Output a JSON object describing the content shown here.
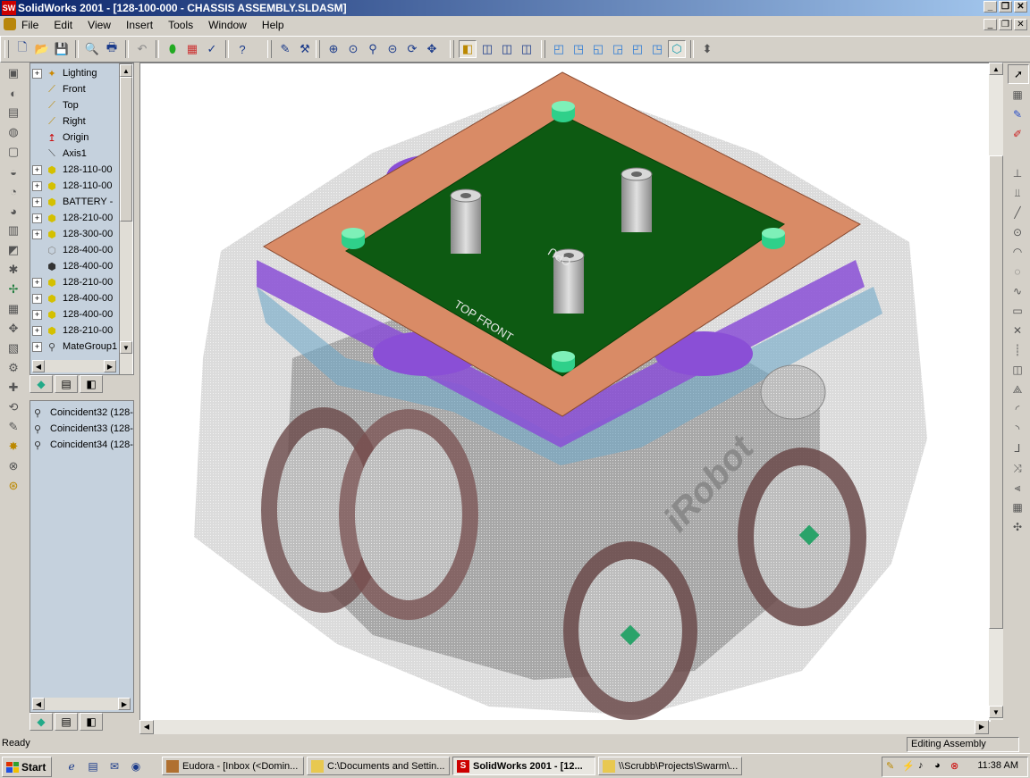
{
  "window": {
    "title": "SolidWorks 2001 - [128-100-000 - CHASSIS ASSEMBLY.SLDASM]",
    "app_icon_text": "SW",
    "controls": {
      "minimize": "_",
      "restore": "❐",
      "close": "✕"
    }
  },
  "menubar": {
    "items": [
      "File",
      "Edit",
      "View",
      "Insert",
      "Tools",
      "Window",
      "Help"
    ]
  },
  "toolbar": {
    "buttons": [
      "new-icon",
      "open-icon",
      "save-icon",
      "print-preview-icon",
      "print-icon",
      "undo-icon",
      "traffic-light-icon",
      "color-palette-icon",
      "options-icon",
      "whats-this-icon",
      "sketch-icon",
      "smart-mate-icon",
      "zoom-fit-icon",
      "zoom-area-icon",
      "zoom-in-out-icon",
      "zoom-selection-icon",
      "rotate-icon",
      "pan-icon",
      "wireframe-icon",
      "hidden-lines-visible-icon",
      "hidden-lines-removed-icon",
      "shaded-edges-icon",
      "front-view-icon",
      "back-view-icon",
      "left-view-icon",
      "right-view-icon",
      "top-view-icon",
      "isometric-view-icon",
      "normal-to-icon"
    ]
  },
  "feature_tree": {
    "items": [
      {
        "label": "Lighting",
        "expandable": true,
        "icon": "lighting-folder-icon"
      },
      {
        "label": "Front",
        "expandable": false,
        "icon": "plane-icon"
      },
      {
        "label": "Top",
        "expandable": false,
        "icon": "plane-icon"
      },
      {
        "label": "Right",
        "expandable": false,
        "icon": "plane-icon"
      },
      {
        "label": "Origin",
        "expandable": false,
        "icon": "origin-icon"
      },
      {
        "label": "Axis1",
        "expandable": false,
        "icon": "axis-icon"
      },
      {
        "label": "128-110-00",
        "expandable": true,
        "icon": "part-icon"
      },
      {
        "label": "128-110-00",
        "expandable": true,
        "icon": "part-icon"
      },
      {
        "label": "BATTERY -",
        "expandable": true,
        "icon": "part-icon"
      },
      {
        "label": "128-210-00",
        "expandable": true,
        "icon": "part-icon"
      },
      {
        "label": "128-300-00",
        "expandable": true,
        "icon": "part-icon"
      },
      {
        "label": "128-400-00",
        "expandable": false,
        "icon": "suppressed-part-icon"
      },
      {
        "label": "128-400-00",
        "expandable": false,
        "icon": "hidden-part-icon"
      },
      {
        "label": "128-210-00",
        "expandable": true,
        "icon": "part-icon"
      },
      {
        "label": "128-400-00",
        "expandable": true,
        "icon": "part-icon"
      },
      {
        "label": "128-400-00",
        "expandable": true,
        "icon": "part-icon"
      },
      {
        "label": "128-210-00",
        "expandable": true,
        "icon": "part-icon"
      },
      {
        "label": "MateGroup1",
        "expandable": true,
        "icon": "mategroup-icon"
      }
    ]
  },
  "mates_panel": {
    "items": [
      "Coincident32 (128-",
      "Coincident33 (128-",
      "Coincident34 (128-"
    ]
  },
  "viewport": {
    "model_labels": {
      "board_front": "TOP FRONT",
      "board_cpu": "CPU",
      "brand": "iRobot"
    }
  },
  "statusbar": {
    "left": "Ready",
    "mode": "Editing Assembly"
  },
  "taskbar": {
    "start_label": "Start",
    "tasks": [
      {
        "label": "Eudora - [Inbox (<Domin...",
        "icon": "eudora-icon",
        "active": false
      },
      {
        "label": "C:\\Documents and Settin...",
        "icon": "folder-icon",
        "active": false
      },
      {
        "label": "SolidWorks 2001 - [12...",
        "icon": "solidworks-icon",
        "active": true
      },
      {
        "label": "\\\\Scrubb\\Projects\\Swarm\\...",
        "icon": "folder-icon",
        "active": false
      }
    ],
    "clock": "11:38 AM"
  },
  "colors": {
    "title_gradient_start": "#0a246a",
    "title_gradient_end": "#a6caf0",
    "tree_background": "#c5d1dd",
    "pcb_green": "#0d5a12",
    "frame_copper": "#d98b66",
    "mount_purple": "#8a4fd6",
    "chassis_gray": "#a8a8a8"
  }
}
